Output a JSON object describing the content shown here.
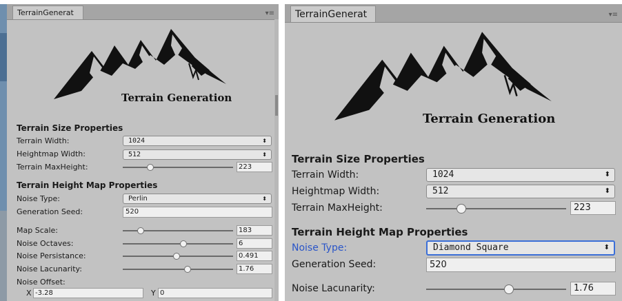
{
  "panels": [
    {
      "tab_title": "TerrainGenerat",
      "logo_text": "Terrain Generation",
      "sections": [
        {
          "title": "Terrain Size Properties",
          "rows": [
            {
              "label": "Terrain Width:",
              "type": "dropdown",
              "value": "1024"
            },
            {
              "label": "Heightmap Width:",
              "type": "dropdown",
              "value": "512"
            },
            {
              "label": "Terrain MaxHeight:",
              "type": "slider",
              "value": "223",
              "fraction": 0.25
            }
          ]
        },
        {
          "title": "Terrain Height Map Properties",
          "rows": [
            {
              "label": "Noise Type:",
              "type": "dropdown",
              "value": "Perlin"
            },
            {
              "label": "Generation Seed:",
              "type": "field",
              "value": "520"
            },
            {
              "label": "Map Scale:",
              "type": "slider",
              "value": "183",
              "fraction": 0.16
            },
            {
              "label": "Noise Octaves:",
              "type": "slider",
              "value": "6",
              "fraction": 0.55
            },
            {
              "label": "Noise Persistance:",
              "type": "slider",
              "value": "0.491",
              "fraction": 0.49
            },
            {
              "label": "Noise Lacunarity:",
              "type": "slider",
              "value": "1.76",
              "fraction": 0.59
            },
            {
              "label": "Noise Offset:",
              "type": "vector2",
              "x_label": "X",
              "x_value": "-3.28",
              "y_label": "Y",
              "y_value": "0"
            }
          ]
        }
      ]
    },
    {
      "tab_title": "TerrainGenerat",
      "logo_text": "Terrain Generation",
      "sections": [
        {
          "title": "Terrain Size Properties",
          "rows": [
            {
              "label": "Terrain Width:",
              "type": "dropdown",
              "value": "1024"
            },
            {
              "label": "Heightmap Width:",
              "type": "dropdown",
              "value": "512"
            },
            {
              "label": "Terrain MaxHeight:",
              "type": "slider",
              "value": "223",
              "fraction": 0.25
            }
          ]
        },
        {
          "title": "Terrain Height Map Properties",
          "rows": [
            {
              "label": "Noise Type:",
              "type": "dropdown",
              "value": "Diamond Square",
              "focused": true
            },
            {
              "label": "Generation Seed:",
              "type": "field",
              "value": "520"
            },
            {
              "label": "Noise Lacunarity:",
              "type": "slider",
              "value": "1.76",
              "fraction": 0.59
            }
          ]
        }
      ]
    }
  ],
  "icons": {
    "dropdown_arrow": "updown-arrow-icon",
    "panel_menu": "panel-menu-icon"
  },
  "colors": {
    "panel_bg": "#c2c2c2",
    "focus_blue": "#3b6fd8",
    "active_label": "#2a55c8"
  }
}
